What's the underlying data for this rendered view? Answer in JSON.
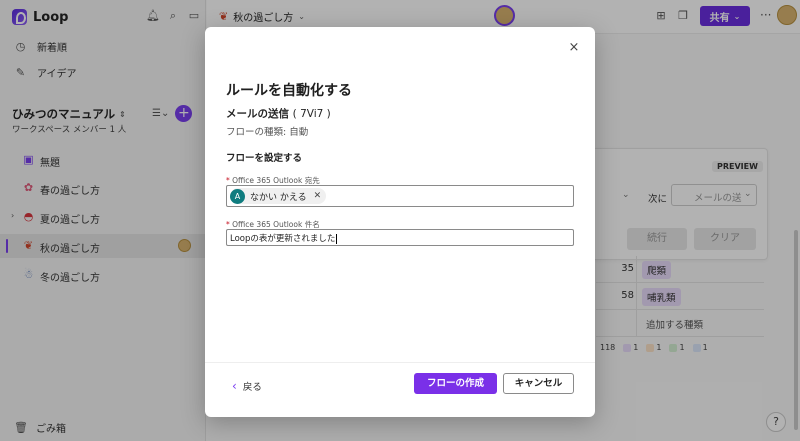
{
  "app": {
    "name": "Loop"
  },
  "sidebar": {
    "nav": [
      {
        "label": "新着順",
        "icon": "clock-icon"
      },
      {
        "label": "アイデア",
        "icon": "pen-icon"
      }
    ],
    "workspace": {
      "title": "ひみつのマニュアル",
      "subtitle": "ワークスペース メンバー 1 人"
    },
    "pages": [
      {
        "label": "無題",
        "icon": "loop-page-icon"
      },
      {
        "label": "春の過ごし方",
        "icon": "sakura-icon"
      },
      {
        "label": "夏の過ごし方",
        "icon": "watermelon-icon"
      },
      {
        "label": "秋の過ごし方",
        "icon": "maple-leaf-icon"
      },
      {
        "label": "冬の過ごし方",
        "icon": "snowman-icon"
      }
    ],
    "trash_label": "ごみ箱"
  },
  "header": {
    "breadcrumb": "秋の過ごし方",
    "share_label": "共有",
    "more_label": "···"
  },
  "background": {
    "preview_badge": "PREVIEW",
    "next_label": "次に",
    "next_select_value": "メールの送",
    "continue_label": "続行",
    "clear_label": "クリア",
    "rows": [
      {
        "num": "35",
        "tag": "爬類"
      },
      {
        "num": "58",
        "tag": "哺乳類"
      }
    ],
    "add_type_label": "追加する種類",
    "summary": [
      {
        "value": "118",
        "color": ""
      },
      {
        "value": "1",
        "color": "#e9dcfb"
      },
      {
        "value": "1",
        "color": "#fde3c8"
      },
      {
        "value": "1",
        "color": "#d5f0d3"
      },
      {
        "value": "1",
        "color": "#dbe7fb"
      }
    ],
    "help_label": "?"
  },
  "modal": {
    "close_label": "×",
    "title": "ルールを自動化する",
    "subtitle": "メールの送信",
    "subtitle_code": "( 7Vi7 )",
    "flow_kind": "フローの種類: 自動",
    "section_title": "フローを設定する",
    "to_field": {
      "label": "Office 365 Outlook 宛先",
      "recipient_initial": "A",
      "recipient_name": "なかい かえる"
    },
    "subject_field": {
      "label": "Office 365 Outlook 件名",
      "value": "Loopの表が更新されました"
    },
    "back_label": "戻る",
    "create_label": "フローの作成",
    "cancel_label": "キャンセル"
  },
  "colors": {
    "accent": "#7a30e8",
    "share": "#6b2fe0"
  }
}
